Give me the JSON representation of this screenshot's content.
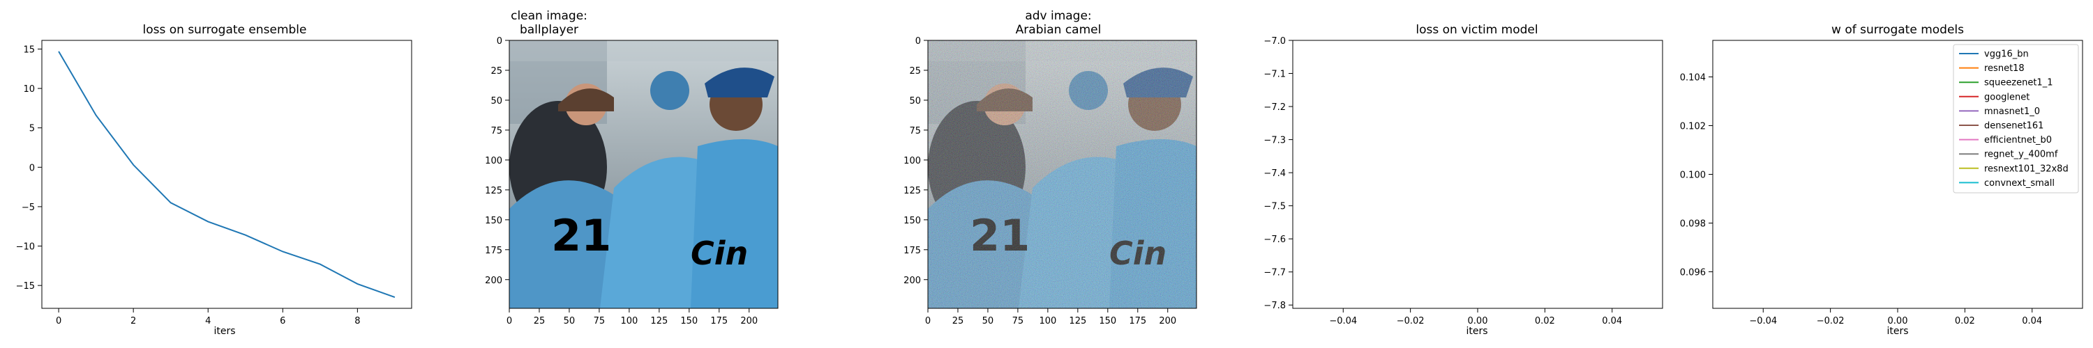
{
  "figure": {
    "background": "#ffffff"
  },
  "chart_data": [
    {
      "type": "line",
      "title": "loss on surrogate ensemble",
      "xlabel": "iters",
      "ylabel": "",
      "x": [
        0,
        1,
        2,
        3,
        4,
        5,
        6,
        7,
        8,
        9
      ],
      "series": [
        {
          "values": [
            14.7,
            6.6,
            0.3,
            -4.5,
            -6.9,
            -8.6,
            -10.7,
            -12.3,
            -14.8,
            -16.5
          ],
          "color": "#1f77b4"
        }
      ],
      "xlim": [
        -0.45,
        9.45
      ],
      "ylim": [
        -17.9,
        16.1
      ],
      "xticks": [
        0,
        2,
        4,
        6,
        8
      ],
      "yticks": [
        15,
        10,
        5,
        0,
        -5,
        -10,
        -15
      ],
      "grid": false
    },
    {
      "type": "image",
      "title_lines": [
        "clean image:",
        "ballplayer"
      ],
      "image_description": "baseball players in light blue jerseys, number 21 visible",
      "xlim": [
        0,
        224
      ],
      "ylim": [
        224,
        0
      ],
      "xticks": [
        0,
        25,
        50,
        75,
        100,
        125,
        150,
        175,
        200
      ],
      "yticks": [
        0,
        25,
        50,
        75,
        100,
        125,
        150,
        175,
        200
      ]
    },
    {
      "type": "image",
      "title_lines": [
        "adv image:",
        "Arabian camel"
      ],
      "image_description": "same baseball players with adversarial noise overlay",
      "xlim": [
        0,
        224
      ],
      "ylim": [
        224,
        0
      ],
      "xticks": [
        0,
        25,
        50,
        75,
        100,
        125,
        150,
        175,
        200
      ],
      "yticks": [
        0,
        25,
        50,
        75,
        100,
        125,
        150,
        175,
        200
      ]
    },
    {
      "type": "line",
      "title": "loss on victim model",
      "xlabel": "iters",
      "ylabel": "",
      "series": [],
      "xlim": [
        -0.055,
        0.055
      ],
      "ylim": [
        -7.81,
        -7.0
      ],
      "xticks": [
        -0.04,
        -0.02,
        0.0,
        0.02,
        0.04
      ],
      "xtick_labels": [
        "−0.04",
        "−0.02",
        "0.00",
        "0.02",
        "0.04"
      ],
      "yticks": [
        -7.0,
        -7.1,
        -7.2,
        -7.3,
        -7.4,
        -7.5,
        -7.6,
        -7.7,
        -7.8
      ],
      "ytick_labels": [
        "−7.0",
        "−7.1",
        "−7.2",
        "−7.3",
        "−7.4",
        "−7.5",
        "−7.6",
        "−7.7",
        "−7.8"
      ],
      "grid": false
    },
    {
      "type": "line",
      "title": "w of surrogate models",
      "xlabel": "iters",
      "ylabel": "",
      "series": [
        {
          "name": "vgg16_bn",
          "color": "#1f77b4",
          "values": []
        },
        {
          "name": "resnet18",
          "color": "#ff7f0e",
          "values": []
        },
        {
          "name": "squeezenet1_1",
          "color": "#2ca02c",
          "values": []
        },
        {
          "name": "googlenet",
          "color": "#d62728",
          "values": []
        },
        {
          "name": "mnasnet1_0",
          "color": "#9467bd",
          "values": []
        },
        {
          "name": "densenet161",
          "color": "#8c564b",
          "values": []
        },
        {
          "name": "efficientnet_b0",
          "color": "#e377c2",
          "values": []
        },
        {
          "name": "regnet_y_400mf",
          "color": "#7f7f7f",
          "values": []
        },
        {
          "name": "resnext101_32x8d",
          "color": "#bcbd22",
          "values": []
        },
        {
          "name": "convnext_small",
          "color": "#17becf",
          "values": []
        }
      ],
      "legend_position": "top-right",
      "xlim": [
        -0.055,
        0.055
      ],
      "ylim": [
        0.0945,
        0.1055
      ],
      "xticks": [
        -0.04,
        -0.02,
        0.0,
        0.02,
        0.04
      ],
      "xtick_labels": [
        "−0.04",
        "−0.02",
        "0.00",
        "0.02",
        "0.04"
      ],
      "yticks": [
        0.104,
        0.102,
        0.1,
        0.098,
        0.096
      ],
      "ytick_labels": [
        "0.104",
        "0.102",
        "0.100",
        "0.098",
        "0.096"
      ],
      "grid": false
    }
  ]
}
